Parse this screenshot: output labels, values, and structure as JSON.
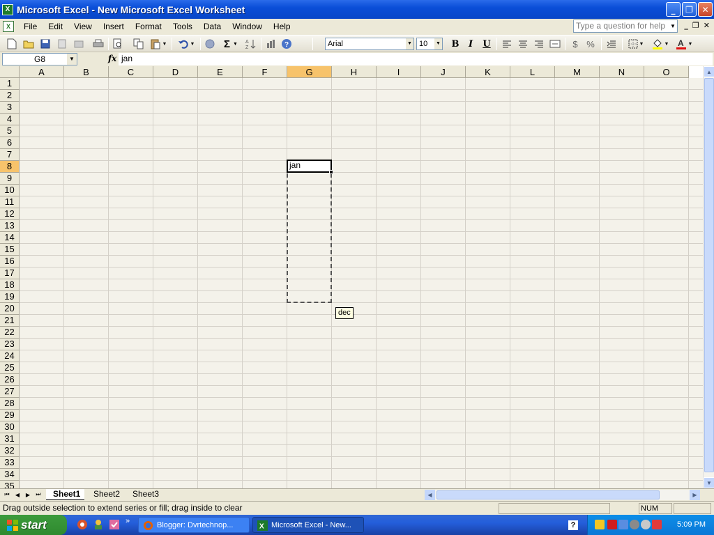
{
  "window": {
    "title": "Microsoft Excel - New Microsoft Excel Worksheet"
  },
  "menu": {
    "items": [
      "File",
      "Edit",
      "View",
      "Insert",
      "Format",
      "Tools",
      "Data",
      "Window",
      "Help"
    ]
  },
  "help_box": {
    "placeholder": "Type a question for help"
  },
  "toolbar": {
    "font_name": "Arial",
    "font_size": "10",
    "bold_label": "B",
    "italic_label": "I",
    "underline_label": "U",
    "sum_label": "Σ",
    "currency_label": "$",
    "percent_label": "%"
  },
  "formula_bar": {
    "name_box": "G8",
    "fx_label": "fx",
    "content": "jan"
  },
  "grid": {
    "columns": [
      "A",
      "B",
      "C",
      "D",
      "E",
      "F",
      "G",
      "H",
      "I",
      "J",
      "K",
      "L",
      "M",
      "N",
      "O"
    ],
    "rows": [
      "1",
      "2",
      "3",
      "4",
      "5",
      "6",
      "7",
      "8",
      "9",
      "10",
      "11",
      "12",
      "13",
      "14",
      "15",
      "16",
      "17",
      "18",
      "19",
      "20",
      "21",
      "22",
      "23",
      "24",
      "25",
      "26",
      "27",
      "28",
      "29",
      "30",
      "31",
      "32",
      "33",
      "34",
      "35"
    ],
    "selected_column": "G",
    "selected_row": "8",
    "active_cell_value": "jan",
    "fill_tooltip": "dec"
  },
  "sheets": {
    "tabs": [
      "Sheet1",
      "Sheet2",
      "Sheet3"
    ],
    "active": "Sheet1"
  },
  "status": {
    "message": "Drag outside selection to extend series or fill; drag inside to clear",
    "num_indicator": "NUM"
  },
  "taskbar": {
    "start_label": "start",
    "tasks": [
      "Blogger: Dvrtechnop...",
      "Microsoft Excel - New..."
    ],
    "clock": "5:09 PM"
  },
  "colors": {
    "selected_header": "#f7c36b",
    "titlebar": "#0a4ed8",
    "start_button": "#3c9b3c"
  }
}
